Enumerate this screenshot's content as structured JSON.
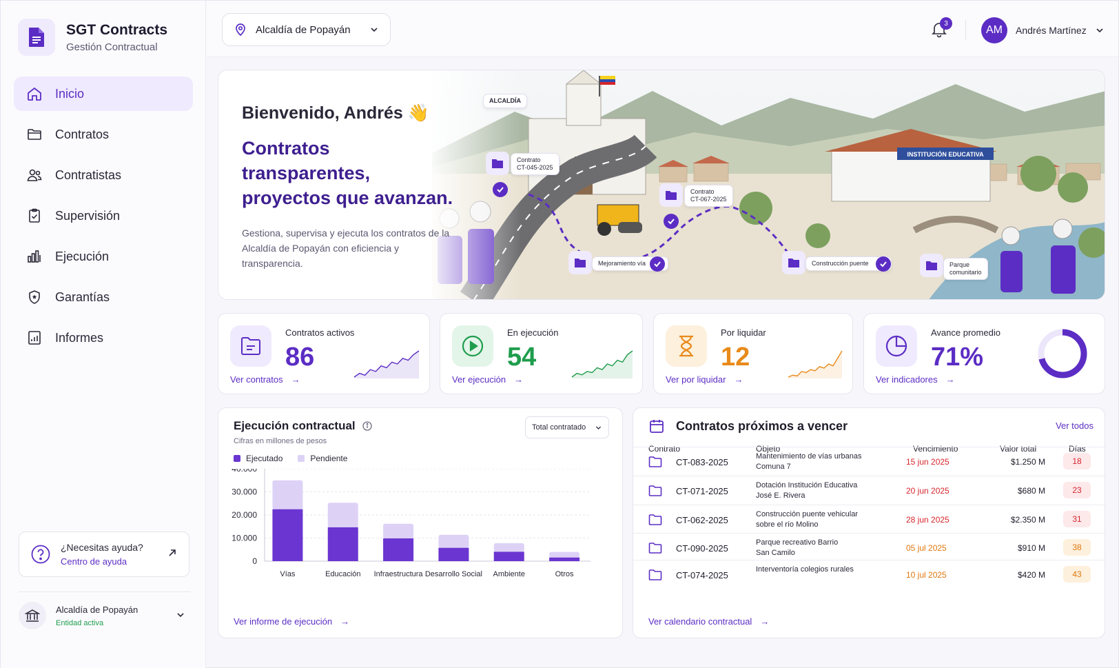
{
  "brand": {
    "title": "SGT Contracts",
    "subtitle": "Gestión Contractual"
  },
  "nav": [
    {
      "label": "Inicio",
      "icon": "home-icon",
      "active": true
    },
    {
      "label": "Contratos",
      "icon": "folder-icon"
    },
    {
      "label": "Contratistas",
      "icon": "users-icon"
    },
    {
      "label": "Supervisión",
      "icon": "clipboard-check-icon"
    },
    {
      "label": "Ejecución",
      "icon": "bar-chart-icon"
    },
    {
      "label": "Garantías",
      "icon": "shield-icon"
    },
    {
      "label": "Informes",
      "icon": "report-icon"
    }
  ],
  "help": {
    "title": "¿Necesitas ayuda?",
    "link": "Centro de ayuda"
  },
  "entity": {
    "name": "Alcaldía de Popayán",
    "status": "Entidad activa"
  },
  "topbar": {
    "org": "Alcaldía de Popayán",
    "notifications": "3",
    "user_initials": "AM",
    "user_name": "Andrés Martínez"
  },
  "hero": {
    "greeting": "Bienvenido, Andrés 👋",
    "headline_1": "Contratos transparentes,",
    "headline_2": "proyectos que avanzan.",
    "description": "Gestiona, supervisa y ejecuta los contratos de la Alcaldía de Popayán con eficiencia y transparencia.",
    "building_sign_1": "ALCALDÍA",
    "building_sign_2": "INSTITUCIÓN EDUCATIVA",
    "markers": {
      "m1_title": "Contrato",
      "m1_code": "CT-045-2025",
      "m2_title": "Contrato",
      "m2_code": "CT-067-2025",
      "m3": "Mejoramiento vía",
      "m4": "Construcción puente",
      "m5_1": "Parque",
      "m5_2": "comunitario"
    }
  },
  "stats": [
    {
      "label": "Contratos activos",
      "value": "86",
      "link": "Ver contratos",
      "color": "#5b2dc4",
      "bg": "#efeafd",
      "icon": "document-folder-icon",
      "spark": [
        2,
        3,
        2.5,
        4,
        3.5,
        5,
        4.5,
        6,
        5.5,
        7,
        6.5,
        8,
        9
      ]
    },
    {
      "label": "En ejecución",
      "value": "54",
      "link": "Ver ejecución",
      "color": "#1f9d4d",
      "bg": "#e3f5e9",
      "icon": "play-circle-icon",
      "spark": [
        2,
        3,
        2.6,
        3.5,
        3.2,
        4.5,
        4,
        5.5,
        5,
        6.5,
        6,
        8,
        9
      ]
    },
    {
      "label": "Por liquidar",
      "value": "12",
      "link": "Ver por liquidar",
      "color": "#e88a1a",
      "bg": "#fdf0dc",
      "icon": "hourglass-icon",
      "spark": [
        2,
        2.5,
        2.3,
        3.5,
        3.2,
        4,
        3.7,
        4.8,
        4.4,
        5.5,
        5,
        7,
        9
      ]
    },
    {
      "label": "Avance promedio",
      "value": "71%",
      "link": "Ver indicadores",
      "color": "#5b2dc4",
      "bg": "#efeafd",
      "icon": "pie-chart-icon",
      "progress": 0.71
    }
  ],
  "chart": {
    "title": "Ejecución contractual",
    "subtitle": "Cifras en millones de pesos",
    "filter": "Total contratado",
    "link": "Ver informe de ejecución",
    "colors": {
      "executed": "#6a35d0",
      "pending": "#ddd2f6"
    }
  },
  "chart_data": {
    "type": "bar",
    "stacked": true,
    "categories": [
      "Vías",
      "Educación",
      "Infraestructura",
      "Desarrollo Social",
      "Ambiente",
      "Otros"
    ],
    "series": [
      {
        "name": "Ejecutado",
        "values": [
          22500,
          14700,
          9900,
          5800,
          4100,
          1600
        ]
      },
      {
        "name": "Pendiente",
        "values": [
          12500,
          10600,
          6300,
          5600,
          3700,
          2400
        ]
      }
    ],
    "ylim": [
      0,
      40000
    ],
    "yticks": [
      "0",
      "10.000",
      "20.000",
      "30.000",
      "40.000"
    ],
    "grid": true,
    "legend": "top-left"
  },
  "expiring": {
    "title": "Contratos próximos a vencer",
    "view_all": "Ver todos",
    "headers": {
      "contract": "Contrato",
      "object": "Objeto",
      "due": "Vencimiento",
      "value": "Valor total",
      "days": "Días"
    },
    "rows": [
      {
        "code": "CT-083-2025",
        "obj1": "Mantenimiento de vías urbanas",
        "obj2": "Comuna 7",
        "due": "15 jun 2025",
        "value": "$1.250 M",
        "days": "18",
        "level": "red"
      },
      {
        "code": "CT-071-2025",
        "obj1": "Dotación Institución Educativa",
        "obj2": "José E. Rivera",
        "due": "20 jun 2025",
        "value": "$680 M",
        "days": "23",
        "level": "red"
      },
      {
        "code": "CT-062-2025",
        "obj1": "Construcción puente vehicular",
        "obj2": "sobre el río Molino",
        "due": "28 jun 2025",
        "value": "$2.350 M",
        "days": "31",
        "level": "red"
      },
      {
        "code": "CT-090-2025",
        "obj1": "Parque recreativo Barrio",
        "obj2": "San Camilo",
        "due": "05 jul 2025",
        "value": "$910 M",
        "days": "38",
        "level": "orange"
      },
      {
        "code": "CT-074-2025",
        "obj1": "Interventoría colegios rurales",
        "obj2": "",
        "due": "10 jul 2025",
        "value": "$420 M",
        "days": "43",
        "level": "orange"
      }
    ],
    "link": "Ver calendario contractual"
  }
}
